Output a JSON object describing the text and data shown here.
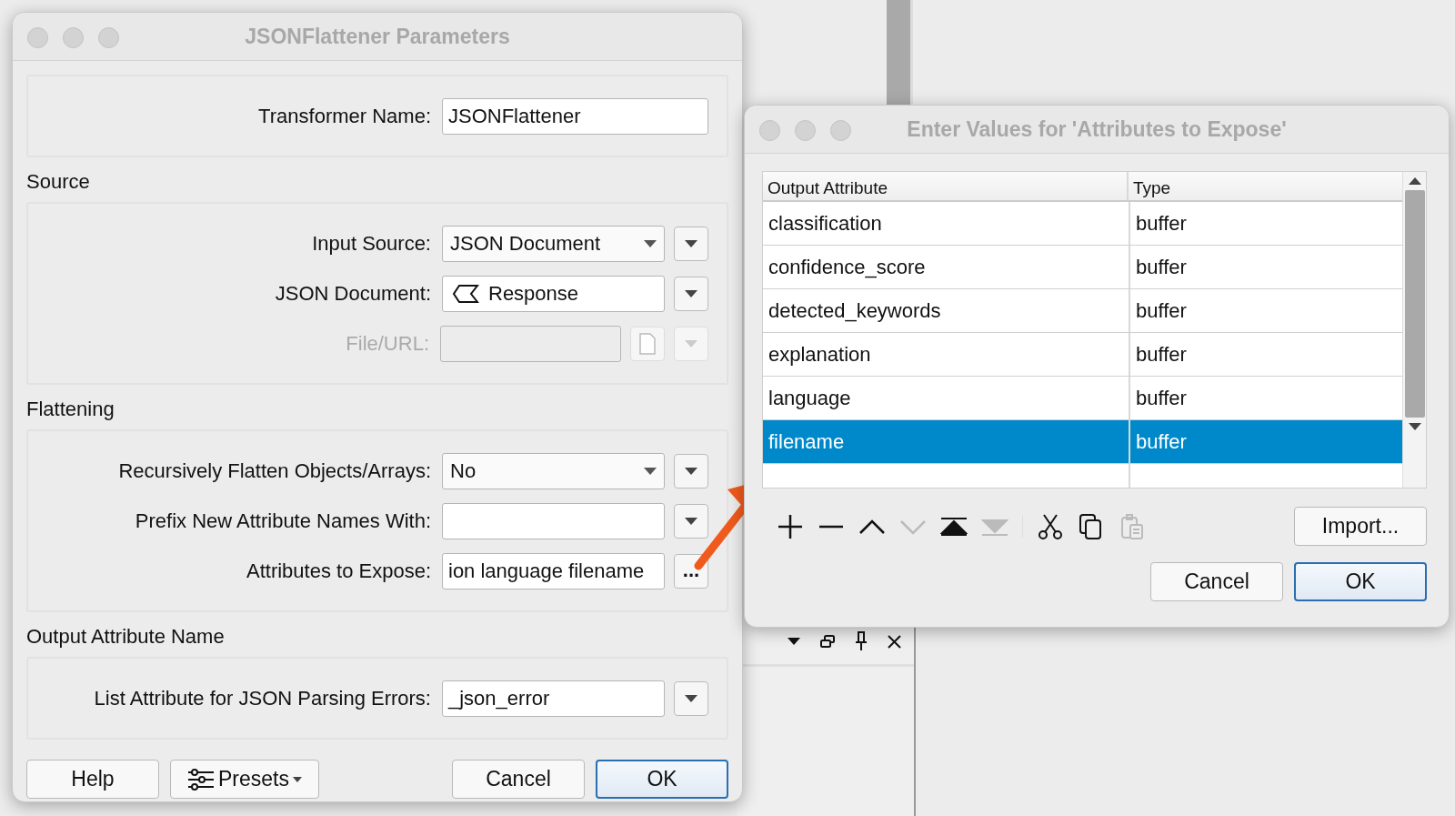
{
  "main_dialog": {
    "title": "JSONFlattener Parameters",
    "sections": [
      {
        "rows": [
          {
            "kind": "text",
            "label": "Transformer Name:",
            "value": "JSONFlattener",
            "disabled": false
          }
        ]
      },
      {
        "heading": "Source",
        "rows": [
          {
            "kind": "combo",
            "label": "Input Source:",
            "value": "JSON Document",
            "disabled": false
          },
          {
            "kind": "attr",
            "label": "JSON Document:",
            "value": "Response",
            "disabled": false
          },
          {
            "kind": "file",
            "label": "File/URL:",
            "disabled": true
          }
        ]
      },
      {
        "heading": "Flattening",
        "rows": [
          {
            "kind": "combo",
            "label": "Recursively Flatten Objects/Arrays:",
            "value": "No",
            "disabled": false
          },
          {
            "kind": "field",
            "label": "Prefix New Attribute Names With:",
            "disabled": false
          },
          {
            "kind": "ellipsis",
            "label": "Attributes to Expose:",
            "value": "ion language filename",
            "button_label": "...",
            "disabled": false
          }
        ]
      },
      {
        "heading": "Output Attribute Name",
        "rows": [
          {
            "kind": "field",
            "label": "List Attribute for JSON Parsing Errors:",
            "value": "_json_error",
            "disabled": false
          }
        ]
      }
    ],
    "buttons": [
      {
        "kind": "help",
        "label": "Help",
        "default": false
      },
      {
        "kind": "presets",
        "label": "Presets",
        "default": false
      },
      {
        "kind": "cancel",
        "label": "Cancel",
        "default": false
      },
      {
        "kind": "ok",
        "label": "OK",
        "default": true
      }
    ]
  },
  "values_dialog": {
    "title": "Enter Values for 'Attributes to Expose'",
    "columns": [
      "Output Attribute",
      "Type"
    ],
    "rows": [
      {
        "attribute": "classification",
        "type": "buffer",
        "selected": false
      },
      {
        "attribute": "confidence_score",
        "type": "buffer",
        "selected": false
      },
      {
        "attribute": "detected_keywords",
        "type": "buffer",
        "selected": false
      },
      {
        "attribute": "explanation",
        "type": "buffer",
        "selected": false
      },
      {
        "attribute": "language",
        "type": "buffer",
        "selected": false
      },
      {
        "attribute": "filename",
        "type": "buffer",
        "selected": true
      }
    ],
    "toolbar": [
      {
        "kind": "add",
        "disabled": false
      },
      {
        "kind": "remove",
        "disabled": false
      },
      {
        "kind": "up",
        "disabled": false
      },
      {
        "kind": "down",
        "disabled": true
      },
      {
        "kind": "top",
        "disabled": false
      },
      {
        "kind": "bottom",
        "disabled": true
      },
      {
        "kind": "cut",
        "disabled": false
      },
      {
        "kind": "copy",
        "disabled": false
      },
      {
        "kind": "paste",
        "disabled": true
      }
    ],
    "import_button": "Import...",
    "buttons": [
      {
        "label": "Cancel",
        "default": false
      },
      {
        "label": "OK",
        "default": true
      }
    ]
  }
}
